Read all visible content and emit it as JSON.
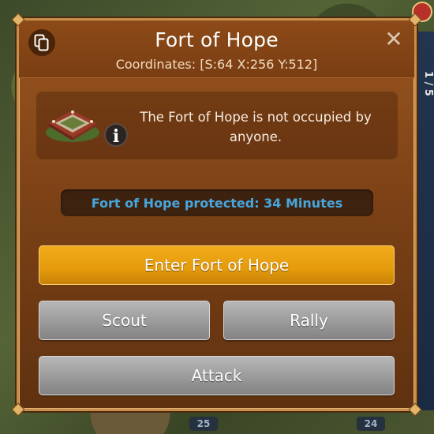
{
  "dialog": {
    "title": "Fort of Hope",
    "coordinates": "Coordinates: [S:64 X:256 Y:512]",
    "copy_icon": "copy-icon",
    "close_label": "✕"
  },
  "info": {
    "message": "The Fort of Hope is not occupied by anyone.",
    "badge_label": "i"
  },
  "protection": {
    "text": "Fort of Hope protected: 34 Minutes",
    "color": "#47a6dc"
  },
  "buttons": {
    "enter": "Enter Fort of Hope",
    "scout": "Scout",
    "rally": "Rally",
    "attack": "Attack"
  },
  "world": {
    "marker_left": "25",
    "marker_right": "24",
    "side_counter": "1 / 5"
  },
  "colors": {
    "primary_button": "#e59b0b",
    "secondary_button": "#9a9a9a",
    "dialog_bg": "#7d4216"
  }
}
